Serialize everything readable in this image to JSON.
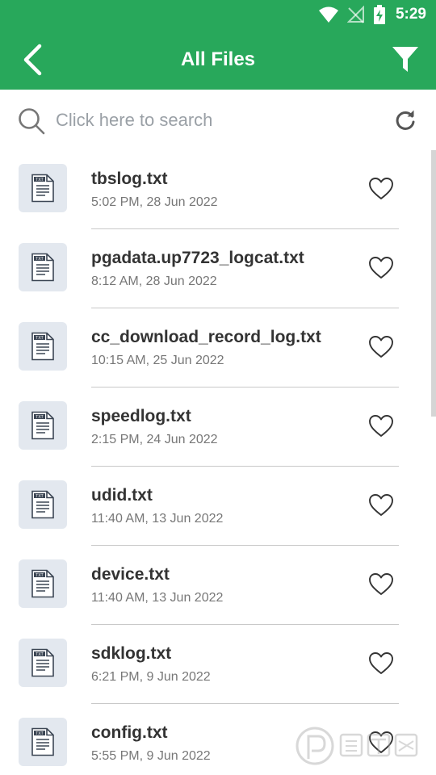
{
  "status_bar": {
    "time": "5:29",
    "icons": [
      "wifi-icon",
      "no-signal-icon",
      "battery-charging-icon"
    ]
  },
  "app_bar": {
    "title": "All Files",
    "back_icon": "chevron-left-icon",
    "filter_icon": "filter-icon"
  },
  "search": {
    "placeholder": "Click here to search",
    "value": "",
    "refresh_icon": "refresh-icon"
  },
  "files": [
    {
      "name": "tbslog.txt",
      "date": "5:02 PM, 28 Jun 2022",
      "type_label": "TXT"
    },
    {
      "name": "pgadata.up7723_logcat.txt",
      "date": "8:12 AM, 28 Jun 2022",
      "type_label": "TXT"
    },
    {
      "name": "cc_download_record_log.txt",
      "date": "10:15 AM, 25 Jun 2022",
      "type_label": "TXT"
    },
    {
      "name": "speedlog.txt",
      "date": "2:15 PM, 24 Jun 2022",
      "type_label": "TXT"
    },
    {
      "name": "udid.txt",
      "date": "11:40 AM, 13 Jun 2022",
      "type_label": "TXT"
    },
    {
      "name": "device.txt",
      "date": "11:40 AM, 13 Jun 2022",
      "type_label": "TXT"
    },
    {
      "name": "sdklog.txt",
      "date": "6:21 PM, 9 Jun 2022",
      "type_label": "TXT"
    },
    {
      "name": "config.txt",
      "date": "5:55 PM, 9 Jun 2022",
      "type_label": "TXT"
    }
  ],
  "colors": {
    "primary": "#28a85b",
    "thumb_bg": "#e3e8ef",
    "text_primary": "#333333",
    "text_secondary": "#777777"
  }
}
